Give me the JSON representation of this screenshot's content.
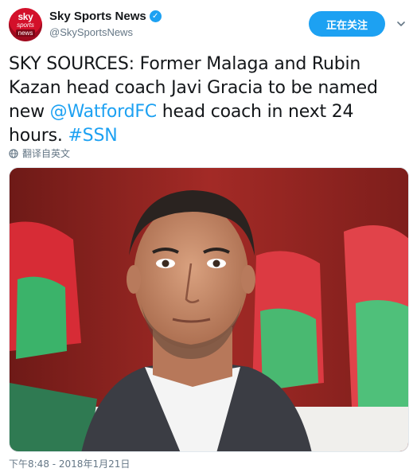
{
  "account": {
    "avatar_text": {
      "sky": "sky",
      "sports": "sports",
      "news": "news"
    },
    "display_name": "Sky Sports News",
    "verified": true,
    "handle": "@SkySportsNews"
  },
  "follow_button": {
    "label": "正在关注"
  },
  "tweet": {
    "text_before": "SKY SOURCES: Former Malaga and Rubin Kazan head coach Javi Gracia to be named new ",
    "mention": "@WatfordFC",
    "text_middle": " head coach in next 24 hours. ",
    "hashtag": "#SSN"
  },
  "translate_label": "翻译自英文",
  "timestamp": "下午8:48 - 2018年1月21日",
  "colors": {
    "accent": "#1da1f2",
    "text": "#14171a",
    "muted": "#657786",
    "brand_red": "#d3102a"
  },
  "icons": {
    "verified": "verified-badge-icon",
    "caret": "chevron-down-icon",
    "translate": "globe-icon"
  }
}
